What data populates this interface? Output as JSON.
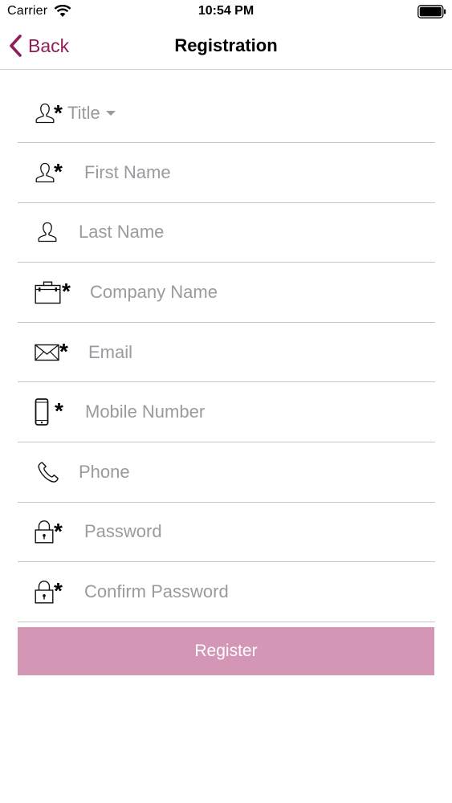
{
  "status_bar": {
    "carrier": "Carrier",
    "time": "10:54 PM"
  },
  "nav": {
    "back_label": "Back",
    "title": "Registration",
    "accent_color": "#8f1d58"
  },
  "form": {
    "title_select": {
      "label": "Title",
      "required": true,
      "icon": "user-icon"
    },
    "fields": [
      {
        "name": "first-name",
        "placeholder": "First Name",
        "required": true,
        "icon": "user-icon"
      },
      {
        "name": "last-name",
        "placeholder": "Last Name",
        "required": false,
        "icon": "user-icon"
      },
      {
        "name": "company-name",
        "placeholder": "Company Name",
        "required": true,
        "icon": "briefcase-icon"
      },
      {
        "name": "email",
        "placeholder": "Email",
        "required": true,
        "icon": "envelope-icon"
      },
      {
        "name": "mobile-number",
        "placeholder": "Mobile Number",
        "required": true,
        "icon": "mobile-phone-icon"
      },
      {
        "name": "phone",
        "placeholder": "Phone",
        "required": false,
        "icon": "phone-icon"
      },
      {
        "name": "password",
        "placeholder": "Password",
        "required": true,
        "icon": "lock-icon"
      },
      {
        "name": "confirm-password",
        "placeholder": "Confirm Password",
        "required": true,
        "icon": "lock-icon"
      }
    ],
    "required_marker": "*"
  },
  "register_button": {
    "label": "Register",
    "color": "#d397b5"
  }
}
